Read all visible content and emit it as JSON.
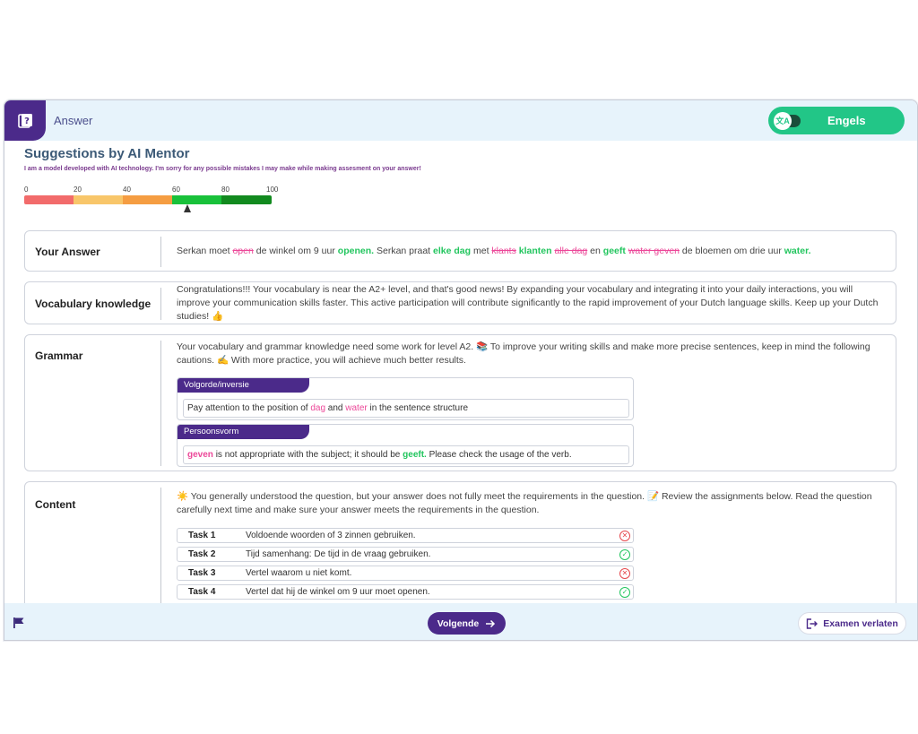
{
  "header": {
    "title": "Answer",
    "language": "Engels",
    "toggle_glyph": "文A"
  },
  "mentor": {
    "title": "Suggestions by AI Mentor",
    "disclaimer": "I am a model developed with AI technology. I'm sorry for any possible mistakes I may make while making assesment on your answer!",
    "scale_ticks": [
      "0",
      "20",
      "40",
      "60",
      "80",
      "100"
    ],
    "scale_value": 66,
    "scale_colors": [
      "#f26b6b",
      "#f8c66a",
      "#f59d42",
      "#19c13a",
      "#128a1f"
    ]
  },
  "your_answer": {
    "label": "Your Answer",
    "t1": "Serkan moet",
    "d1": "open",
    "t2": "de winkel om 9 uur",
    "c1": "openen.",
    "t3": "Serkan praat",
    "c2": "elke dag",
    "t4": "met",
    "d2": "klants",
    "c3": "klanten",
    "d3": "alle dag",
    "t5": "en",
    "c4": "geeft",
    "d4": "water geven",
    "t6": "de bloemen om drie uur",
    "c5": "water."
  },
  "vocabulary": {
    "label": "Vocabulary knowledge",
    "text": "Congratulations!!! Your vocabulary is near the A2+ level, and that's good news! By expanding your vocabulary and integrating it into your daily interactions, you will improve your communication skills faster. This active participation will contribute significantly to the rapid improvement of your Dutch language skills. Keep up your Dutch studies! 👍"
  },
  "grammar": {
    "label": "Grammar",
    "text": "Your vocabulary and grammar knowledge need some work for level A2. 📚 To improve your writing skills and make more precise sentences, keep in mind the following cautions. ✍️ With more practice, you will achieve much better results.",
    "box1": {
      "tag": "Volgorde/inversie",
      "t1": "Pay attention to the position of",
      "w1": "dag",
      "t2": "and",
      "w2": "water",
      "t3": "in the sentence structure"
    },
    "box2": {
      "tag": "Persoonsvorm",
      "w1": "geven",
      "t1": "is not appropriate with the subject; it should be",
      "w2": "geeft.",
      "t2": "Please check the usage of the verb."
    }
  },
  "content": {
    "label": "Content",
    "text": "☀️ You generally understood the question, but your answer does not fully meet the requirements in the question. 📝 Review the assignments below. Read the question carefully next time and make sure your answer meets the requirements in the question.",
    "tasks": [
      {
        "name": "Task 1",
        "text": "Voldoende woorden of 3 zinnen gebruiken.",
        "status": "fail"
      },
      {
        "name": "Task 2",
        "text": "Tijd samenhang: De tijd in de vraag gebruiken.",
        "status": "pass"
      },
      {
        "name": "Task 3",
        "text": "Vertel waarom u niet komt.",
        "status": "fail"
      },
      {
        "name": "Task 4",
        "text": "Vertel dat hij de winkel om 9 uur moet openen.",
        "status": "pass"
      }
    ]
  },
  "footer": {
    "next_label": "Volgende",
    "exit_label": "Examen verlaten"
  }
}
